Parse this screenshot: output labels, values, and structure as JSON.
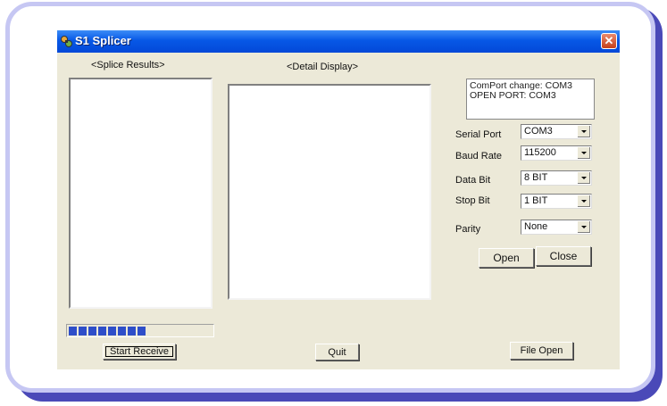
{
  "window": {
    "title": "S1 Splicer",
    "close_icon": "close-icon"
  },
  "splice_results": {
    "label": "<Splice Results>"
  },
  "detail_display": {
    "label": "<Detail Display>"
  },
  "status_log": {
    "lines": [
      "ComPort change: COM3",
      "OPEN PORT: COM3"
    ]
  },
  "settings": {
    "serial_port": {
      "label": "Serial Port",
      "value": "COM3"
    },
    "baud_rate": {
      "label": "Baud Rate",
      "value": "115200"
    },
    "data_bit": {
      "label": "Data Bit",
      "value": "8 BIT"
    },
    "stop_bit": {
      "label": "Stop Bit",
      "value": "1 BIT"
    },
    "parity": {
      "label": "Parity",
      "value": "None"
    }
  },
  "buttons": {
    "open": "Open",
    "close": "Close",
    "start_receive": "Start Receive",
    "quit": "Quit",
    "file_open": "File Open"
  },
  "progress": {
    "segments_filled": 9,
    "fraction": 0.55
  },
  "colors": {
    "titlebar": "#0758e6",
    "window_bg": "#ece9d8",
    "progress": "#2e4ec9",
    "frame_border": "#c6c7f3",
    "frame_shadow": "#4a49b8"
  }
}
